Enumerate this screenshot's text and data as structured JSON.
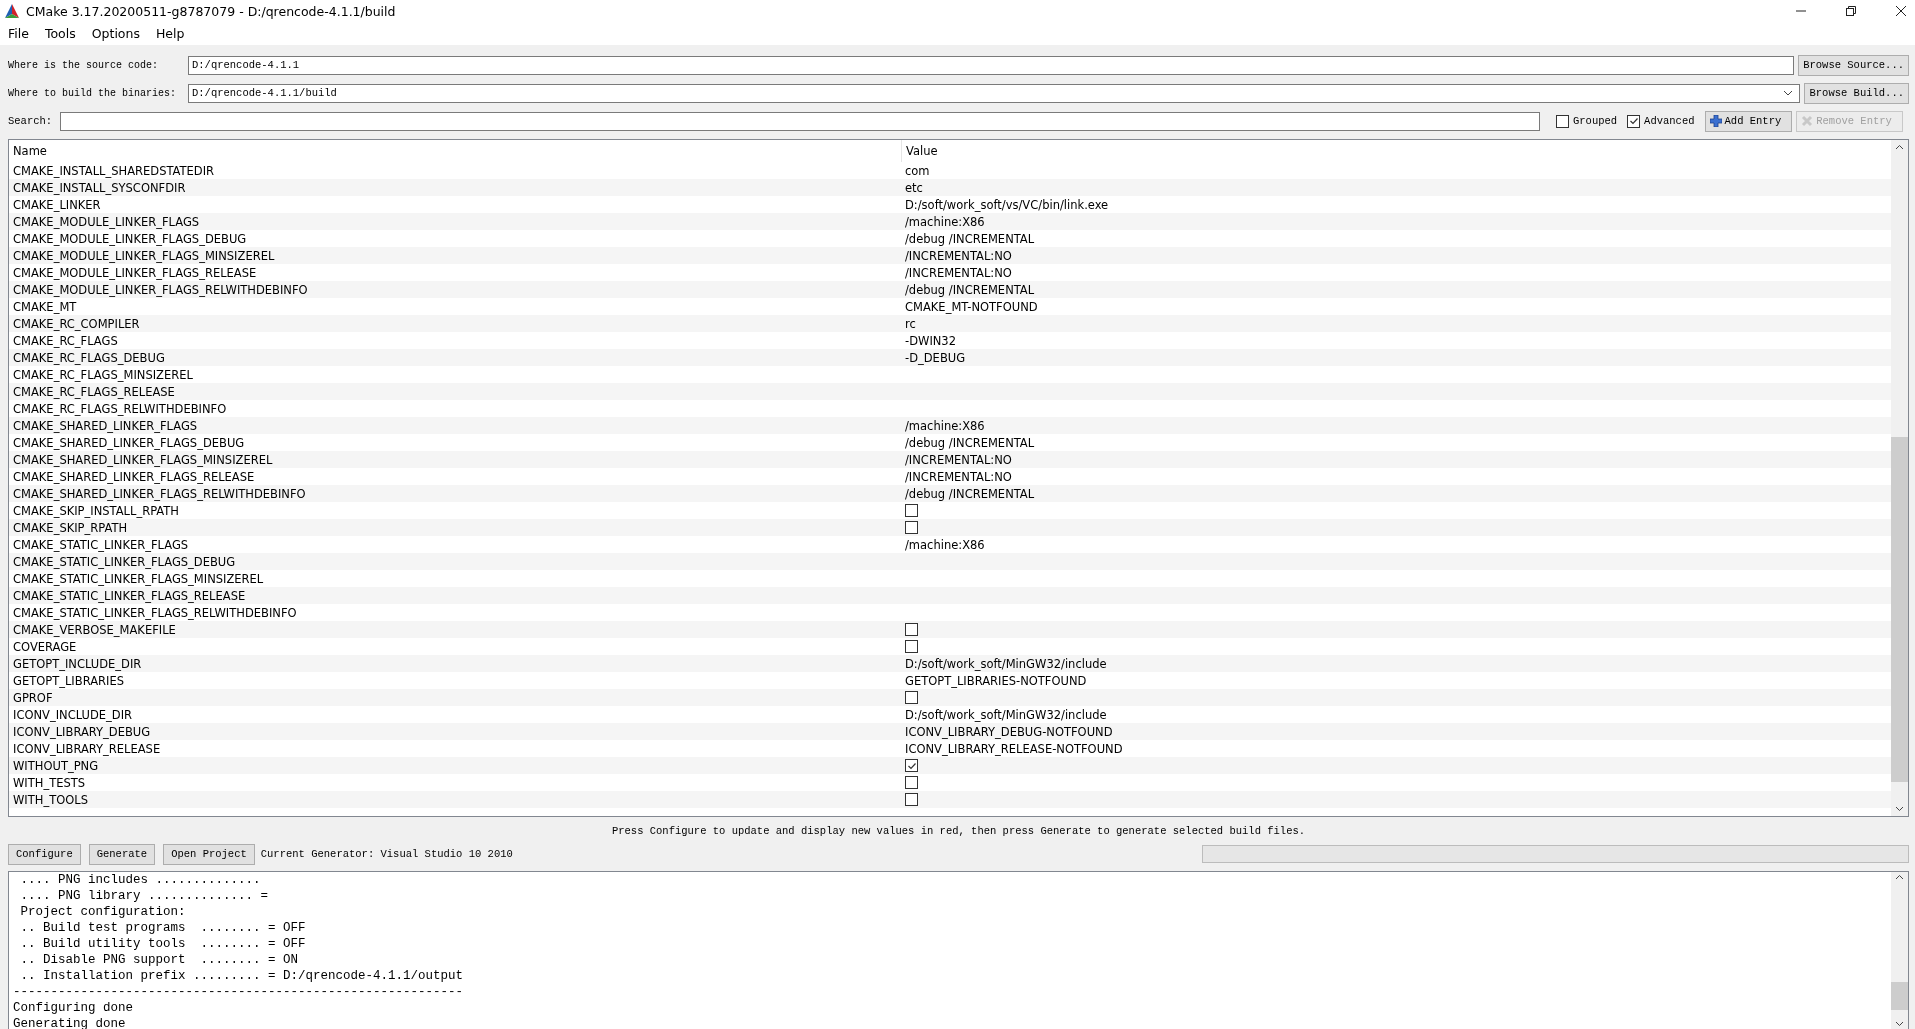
{
  "window": {
    "title": "CMake 3.17.20200511-g8787079 - D:/qrencode-4.1.1/build"
  },
  "menu": [
    "File",
    "Tools",
    "Options",
    "Help"
  ],
  "source": {
    "label": "Where is the source code:",
    "value": "D:/qrencode-4.1.1",
    "button": "Browse Source..."
  },
  "build": {
    "label": "Where to build the binaries:",
    "value": "D:/qrencode-4.1.1/build",
    "button": "Browse Build..."
  },
  "search": {
    "label": "Search:"
  },
  "options": [
    {
      "label": "Grouped",
      "checked": false
    },
    {
      "label": "Advanced",
      "checked": true
    }
  ],
  "add_entry": {
    "label": "Add Entry",
    "disabled": false
  },
  "remove_entry": {
    "label": "Remove Entry",
    "disabled": true
  },
  "table": {
    "columns": [
      "Name",
      "Value"
    ],
    "rows": [
      {
        "name": "CMAKE_INSTALL_SHAREDSTATEDIR",
        "kind": "text",
        "value": "com"
      },
      {
        "name": "CMAKE_INSTALL_SYSCONFDIR",
        "kind": "text",
        "value": "etc"
      },
      {
        "name": "CMAKE_LINKER",
        "kind": "text",
        "value": "D:/soft/work_soft/vs/VC/bin/link.exe"
      },
      {
        "name": "CMAKE_MODULE_LINKER_FLAGS",
        "kind": "text",
        "value": "/machine:X86"
      },
      {
        "name": "CMAKE_MODULE_LINKER_FLAGS_DEBUG",
        "kind": "text",
        "value": "/debug /INCREMENTAL"
      },
      {
        "name": "CMAKE_MODULE_LINKER_FLAGS_MINSIZEREL",
        "kind": "text",
        "value": "/INCREMENTAL:NO"
      },
      {
        "name": "CMAKE_MODULE_LINKER_FLAGS_RELEASE",
        "kind": "text",
        "value": "/INCREMENTAL:NO"
      },
      {
        "name": "CMAKE_MODULE_LINKER_FLAGS_RELWITHDEBINFO",
        "kind": "text",
        "value": "/debug /INCREMENTAL"
      },
      {
        "name": "CMAKE_MT",
        "kind": "text",
        "value": "CMAKE_MT-NOTFOUND"
      },
      {
        "name": "CMAKE_RC_COMPILER",
        "kind": "text",
        "value": "rc"
      },
      {
        "name": "CMAKE_RC_FLAGS",
        "kind": "text",
        "value": "-DWIN32"
      },
      {
        "name": "CMAKE_RC_FLAGS_DEBUG",
        "kind": "text",
        "value": "-D_DEBUG"
      },
      {
        "name": "CMAKE_RC_FLAGS_MINSIZEREL",
        "kind": "empty"
      },
      {
        "name": "CMAKE_RC_FLAGS_RELEASE",
        "kind": "empty"
      },
      {
        "name": "CMAKE_RC_FLAGS_RELWITHDEBINFO",
        "kind": "empty"
      },
      {
        "name": "CMAKE_SHARED_LINKER_FLAGS",
        "kind": "text",
        "value": "/machine:X86"
      },
      {
        "name": "CMAKE_SHARED_LINKER_FLAGS_DEBUG",
        "kind": "text",
        "value": "/debug /INCREMENTAL"
      },
      {
        "name": "CMAKE_SHARED_LINKER_FLAGS_MINSIZEREL",
        "kind": "text",
        "value": "/INCREMENTAL:NO"
      },
      {
        "name": "CMAKE_SHARED_LINKER_FLAGS_RELEASE",
        "kind": "text",
        "value": "/INCREMENTAL:NO"
      },
      {
        "name": "CMAKE_SHARED_LINKER_FLAGS_RELWITHDEBINFO",
        "kind": "text",
        "value": "/debug /INCREMENTAL"
      },
      {
        "name": "CMAKE_SKIP_INSTALL_RPATH",
        "kind": "bool",
        "checked": false
      },
      {
        "name": "CMAKE_SKIP_RPATH",
        "kind": "bool",
        "checked": false
      },
      {
        "name": "CMAKE_STATIC_LINKER_FLAGS",
        "kind": "text",
        "value": "/machine:X86"
      },
      {
        "name": "CMAKE_STATIC_LINKER_FLAGS_DEBUG",
        "kind": "empty"
      },
      {
        "name": "CMAKE_STATIC_LINKER_FLAGS_MINSIZEREL",
        "kind": "empty"
      },
      {
        "name": "CMAKE_STATIC_LINKER_FLAGS_RELEASE",
        "kind": "empty"
      },
      {
        "name": "CMAKE_STATIC_LINKER_FLAGS_RELWITHDEBINFO",
        "kind": "empty"
      },
      {
        "name": "CMAKE_VERBOSE_MAKEFILE",
        "kind": "bool",
        "checked": false
      },
      {
        "name": "COVERAGE",
        "kind": "bool",
        "checked": false
      },
      {
        "name": "GETOPT_INCLUDE_DIR",
        "kind": "text",
        "value": "D:/soft/work_soft/MinGW32/include"
      },
      {
        "name": "GETOPT_LIBRARIES",
        "kind": "text",
        "value": "GETOPT_LIBRARIES-NOTFOUND"
      },
      {
        "name": "GPROF",
        "kind": "bool",
        "checked": false
      },
      {
        "name": "ICONV_INCLUDE_DIR",
        "kind": "text",
        "value": "D:/soft/work_soft/MinGW32/include"
      },
      {
        "name": "ICONV_LIBRARY_DEBUG",
        "kind": "text",
        "value": "ICONV_LIBRARY_DEBUG-NOTFOUND"
      },
      {
        "name": "ICONV_LIBRARY_RELEASE",
        "kind": "text",
        "value": "ICONV_LIBRARY_RELEASE-NOTFOUND"
      },
      {
        "name": "WITHOUT_PNG",
        "kind": "bool",
        "checked": true
      },
      {
        "name": "WITH_TESTS",
        "kind": "bool",
        "checked": false
      },
      {
        "name": "WITH_TOOLS",
        "kind": "bool",
        "checked": false
      }
    ]
  },
  "hint": "Press Configure to update and display new values in red, then press Generate to generate selected build files.",
  "actions": [
    "Configure",
    "Generate",
    "Open Project"
  ],
  "generator": "Current Generator: Visual Studio 10 2010",
  "progress": {
    "level": 0
  },
  "output": [
    " .... PNG includes ..............",
    " .... PNG library .............. =",
    " Project configuration:",
    " .. Build test programs  ........ = OFF",
    " .. Build utility tools  ........ = OFF",
    " .. Disable PNG support  ........ = ON",
    " .. Installation prefix ......... = D:/qrencode-4.1.1/output",
    "------------------------------------------------------------",
    "Configuring done",
    "Generating done"
  ]
}
